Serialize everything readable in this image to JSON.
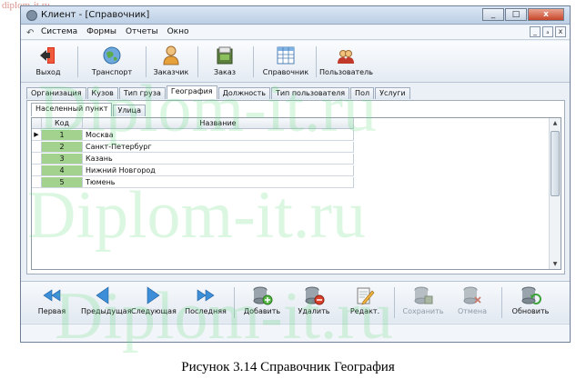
{
  "watermark": {
    "url": "diplom-it.ru",
    "big": "Diplom-it.ru"
  },
  "window": {
    "title": "Клиент - [Справочник]",
    "minimize": "_",
    "maximize": "□",
    "close": "x"
  },
  "menu": {
    "items": [
      "Система",
      "Формы",
      "Отчеты",
      "Окно"
    ],
    "mdi_min": "_",
    "mdi_restore": "ₐ",
    "mdi_close": "x"
  },
  "toolbar": {
    "exit": "Выход",
    "transport": "Транспорт",
    "customer": "Заказчик",
    "order": "Заказ",
    "directory": "Справочник",
    "user": "Пользователь"
  },
  "tabs": [
    "Организация",
    "Кузов",
    "Тип груза",
    "География",
    "Должность",
    "Тип пользователя",
    "Пол",
    "Услуги"
  ],
  "active_tab": "География",
  "subtabs": [
    "Населенный пункт",
    "Улица"
  ],
  "grid": {
    "columns": {
      "code": "Код",
      "name": "Название"
    },
    "rows": [
      {
        "code": "1",
        "name": "Москва"
      },
      {
        "code": "2",
        "name": "Санкт-Петербург"
      },
      {
        "code": "3",
        "name": "Казань"
      },
      {
        "code": "4",
        "name": "Нижний Новгород"
      },
      {
        "code": "5",
        "name": "Тюмень"
      }
    ]
  },
  "nav": {
    "first": "Первая",
    "prev": "Предыдущая",
    "next": "Следующая",
    "last": "Последняя",
    "add": "Добавить",
    "delete": "Удалить",
    "edit": "Редакт.",
    "save": "Сохранить",
    "cancel": "Отмена",
    "refresh": "Обновить"
  },
  "caption": "Рисунок 3.14 Справочник География",
  "colors": {
    "code_cell": "#a3d28e",
    "nav_arrow": "#3c8ed8",
    "exit_red": "#d7301f"
  }
}
